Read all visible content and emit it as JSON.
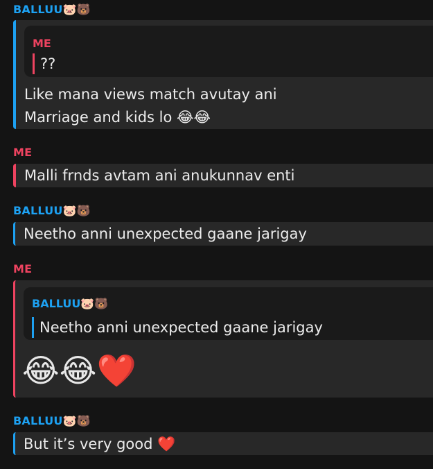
{
  "messages": {
    "m0": {
      "sender": "BALLUU🐷🐻",
      "quote_sender": "ME",
      "quote_text": "??",
      "line1": "Like mana views match avutay ani",
      "line2": "Marriage and kids lo 😂😂"
    },
    "m1": {
      "sender": "ME",
      "text": "Malli frnds avtam ani anukunnav enti"
    },
    "m2": {
      "sender": "BALLUU🐷🐻",
      "text": "Neetho anni unexpected gaane jarigay"
    },
    "m3": {
      "sender": "ME",
      "quote_sender": "BALLUU🐷🐻",
      "quote_text": "Neetho anni unexpected gaane jarigay",
      "text": "😂😂❤️"
    },
    "m4": {
      "sender": "BALLUU🐷🐻",
      "text": "But it’s very good ❤️"
    }
  },
  "colors": {
    "background": "#141414",
    "bubble": "#282828",
    "quote_bg": "#1a1a1a",
    "balluu": "#1da1f2",
    "me": "#ee4360"
  }
}
